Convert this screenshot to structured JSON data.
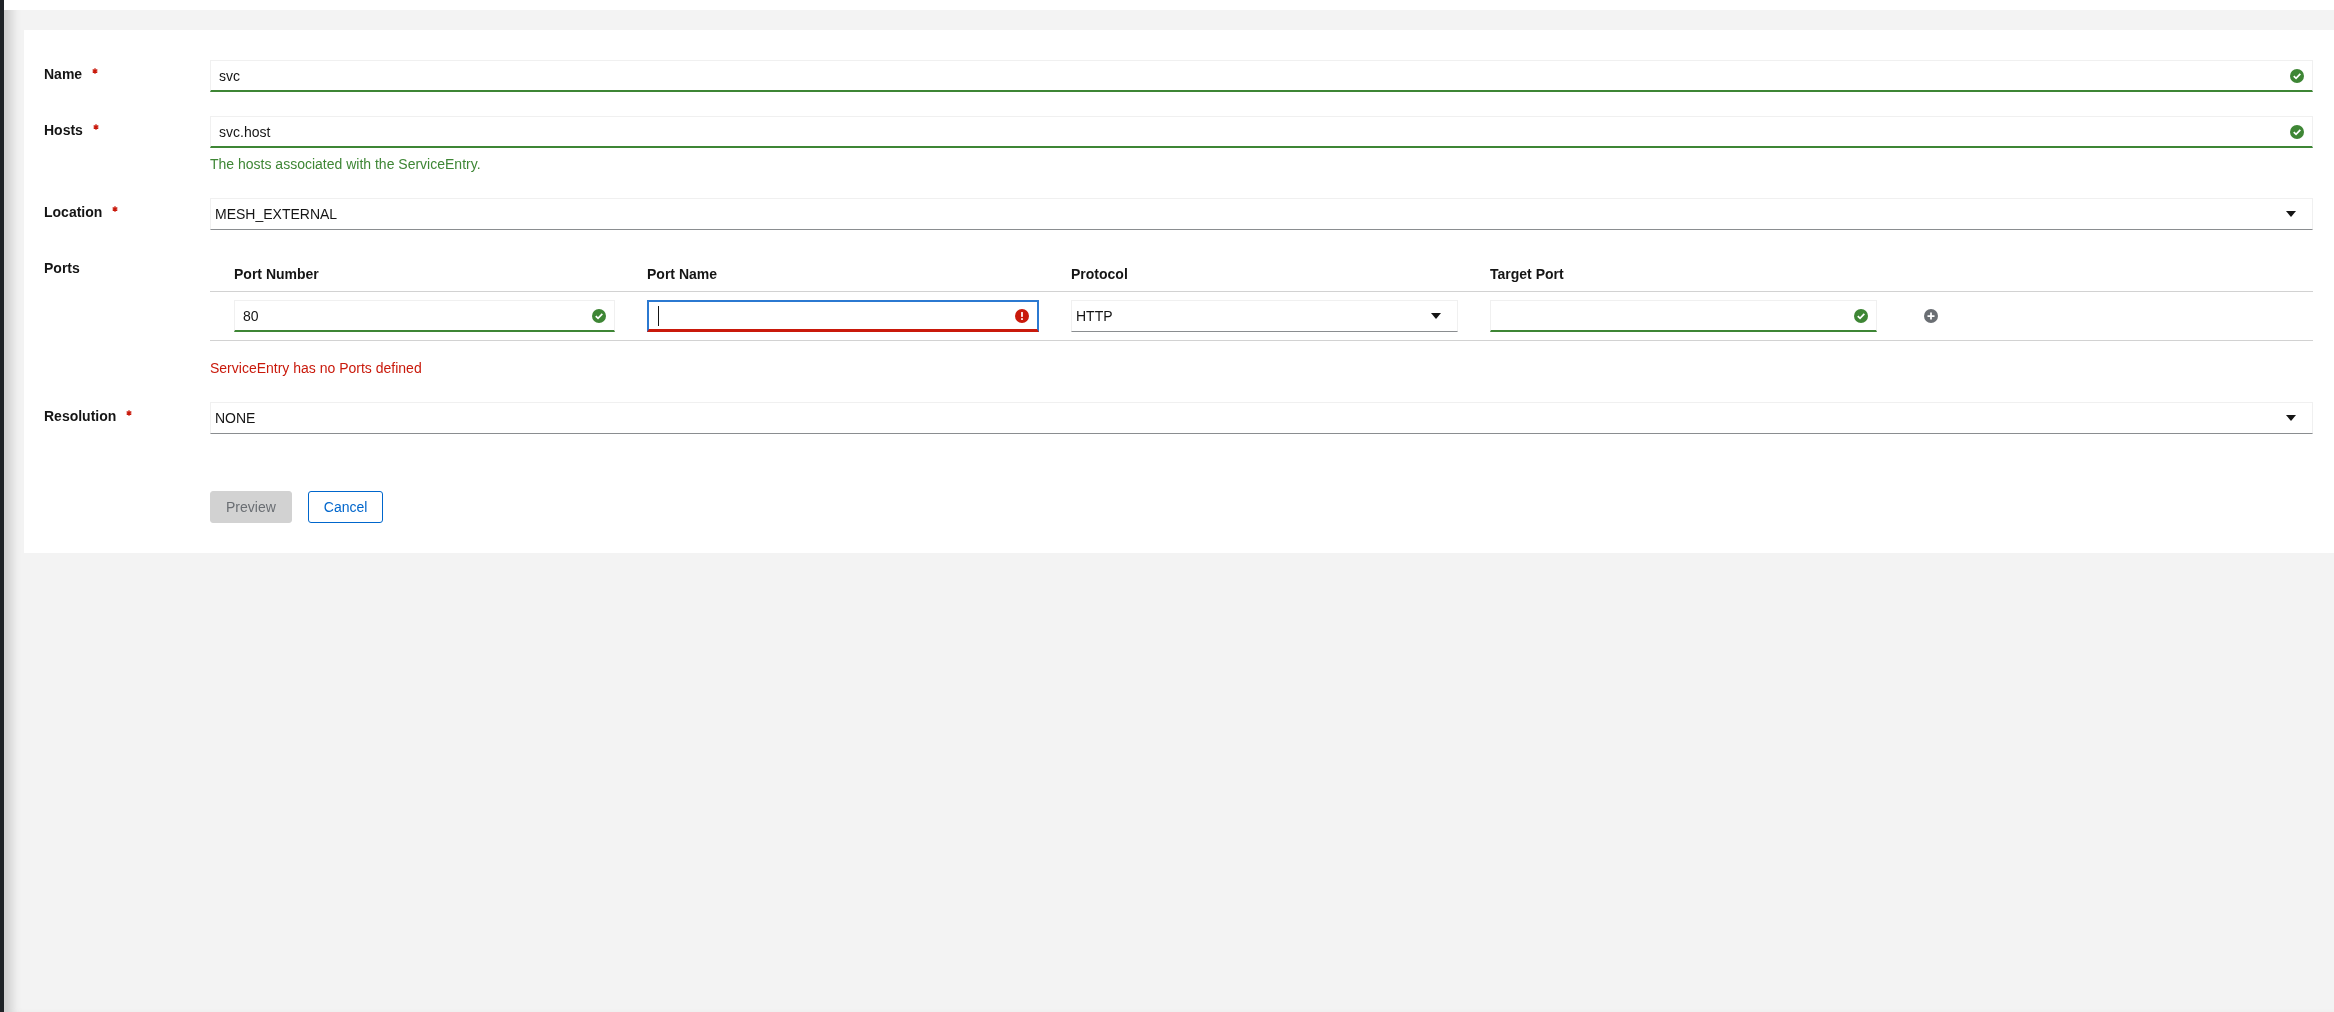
{
  "form": {
    "fields": [
      {
        "kind": "text",
        "label": "Name",
        "required": true,
        "value": "svc",
        "valid": true
      },
      {
        "kind": "text",
        "label": "Hosts",
        "required": true,
        "value": "svc.host",
        "valid": true,
        "helper": "The hosts associated with the ServiceEntry."
      },
      {
        "kind": "select",
        "label": "Location",
        "required": true,
        "value": "MESH_EXTERNAL"
      },
      {
        "kind": "ports",
        "label": "Ports",
        "required": false,
        "columns": [
          "Port Number",
          "Port Name",
          "Protocol",
          "Target Port"
        ],
        "rows": [
          {
            "cells": [
              {
                "kind": "text",
                "value": "80",
                "valid": true,
                "focused": false
              },
              {
                "kind": "text",
                "valid": false,
                "focused": true
              },
              {
                "kind": "select",
                "value": "HTTP",
                "focused": false
              },
              {
                "kind": "text",
                "valid": true,
                "focused": false
              }
            ]
          }
        ],
        "error": "ServiceEntry has no Ports defined"
      },
      {
        "kind": "select",
        "label": "Resolution",
        "required": true,
        "value": "NONE"
      }
    ]
  },
  "buttons": [
    {
      "label": "Preview",
      "kind": "primary",
      "disabled": true
    },
    {
      "label": "Cancel",
      "kind": "secondary",
      "disabled": false
    }
  ]
}
